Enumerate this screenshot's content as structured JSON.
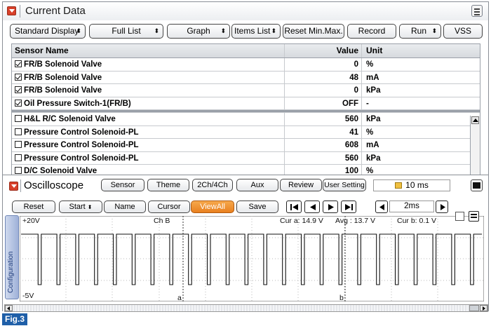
{
  "header": {
    "title": "Current Data"
  },
  "toolbar": {
    "buttons": [
      {
        "label": "Standard Display",
        "dropdown": true
      },
      {
        "label": "Full List",
        "dropdown": true
      },
      {
        "label": "Graph",
        "dropdown": true
      },
      {
        "label": "Items List",
        "dropdown": true
      },
      {
        "label": "Reset Min.Max.",
        "dropdown": false
      },
      {
        "label": "Record",
        "dropdown": false
      },
      {
        "label": "Run",
        "dropdown": true
      },
      {
        "label": "VSS",
        "dropdown": false
      }
    ]
  },
  "table": {
    "headers": {
      "name": "Sensor Name",
      "value": "Value",
      "unit": "Unit"
    },
    "selected_rows": [
      {
        "name": "FR/B Solenoid Valve",
        "value": "0",
        "unit": "%",
        "checked": true
      },
      {
        "name": "FR/B Solenoid Valve",
        "value": "48",
        "unit": "mA",
        "checked": true
      },
      {
        "name": "FR/B Solenoid Valve",
        "value": "0",
        "unit": "kPa",
        "checked": true
      },
      {
        "name": "Oil Pressure Switch-1(FR/B)",
        "value": "OFF",
        "unit": "-",
        "checked": true
      }
    ],
    "other_rows": [
      {
        "name": "H&L R/C Solenoid Valve",
        "value": "560",
        "unit": "kPa",
        "checked": false
      },
      {
        "name": "Pressure Control Solenoid-PL",
        "value": "41",
        "unit": "%",
        "checked": false
      },
      {
        "name": "Pressure Control Solenoid-PL",
        "value": "608",
        "unit": "mA",
        "checked": false
      },
      {
        "name": "Pressure Control Solenoid-PL",
        "value": "560",
        "unit": "kPa",
        "checked": false
      },
      {
        "name": "D/C Solenoid Valve",
        "value": "100",
        "unit": "%",
        "checked": false
      }
    ]
  },
  "oscilloscope": {
    "title": "Oscilloscope",
    "tabs": [
      "Sensor",
      "Theme",
      "2Ch/4Ch",
      "Aux",
      "Review",
      "User Setting"
    ],
    "time_display": "10 ms",
    "controls": {
      "reset": "Reset",
      "start": "Start",
      "name": "Name",
      "cursor": "Cursor",
      "viewall": "ViewAll",
      "save": "Save"
    },
    "time_scale": "2ms",
    "config_label": "Configuration",
    "plot": {
      "top_label": "+20V",
      "bottom_label": "-5V",
      "channel": "Ch B",
      "cursor_a": "Cur a: 14.9 V",
      "avg": "Avg : 13.7 V",
      "cursor_b": "Cur b: 0.1 V",
      "marker_a": "a",
      "marker_b": "b"
    }
  },
  "figure_label": "Fig.3"
}
